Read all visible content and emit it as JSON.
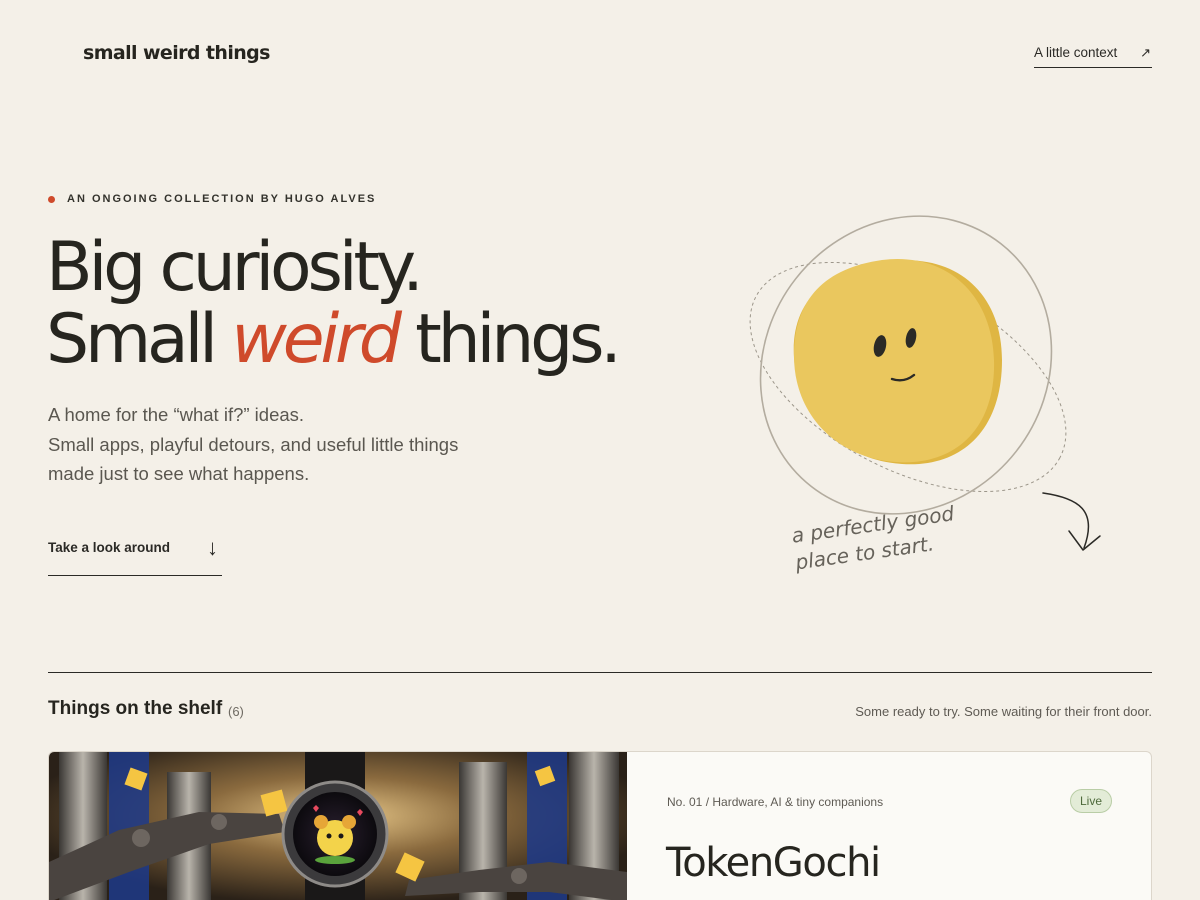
{
  "header": {
    "brand": "small weird things",
    "context_link": {
      "label": "A little context",
      "icon": "arrow-up-right-icon",
      "arrow_glyph": "↗"
    }
  },
  "hero": {
    "eyebrow": "AN ONGOING COLLECTION BY HUGO ALVES",
    "headline": {
      "line1": "Big curiosity.",
      "line2_start": "Small ",
      "line2_accent": "weird",
      "line2_end": " things."
    },
    "intro": [
      "A home for the “what if?” ideas.",
      "Small apps, playful detours, and useful little things",
      "made just to see what happens."
    ],
    "cta": {
      "label": "Take a look around",
      "icon": "arrow-down-icon",
      "arrow_glyph": "↓"
    },
    "scribble": [
      "a perfectly good",
      "place to start."
    ]
  },
  "shelf": {
    "title": "Things on the shelf",
    "count": "(6)",
    "note": "Some ready to try. Some waiting for their front door.",
    "items": [
      {
        "meta": "No. 01 / Hardware, AI & tiny companions",
        "status": "Live",
        "title": "TokenGochi"
      }
    ]
  },
  "colors": {
    "background": "#f4f0e8",
    "text": "#26251f",
    "accent": "#cf4a2b",
    "blob": "#eac75e",
    "status_live_bg": "#e3ecd7"
  }
}
